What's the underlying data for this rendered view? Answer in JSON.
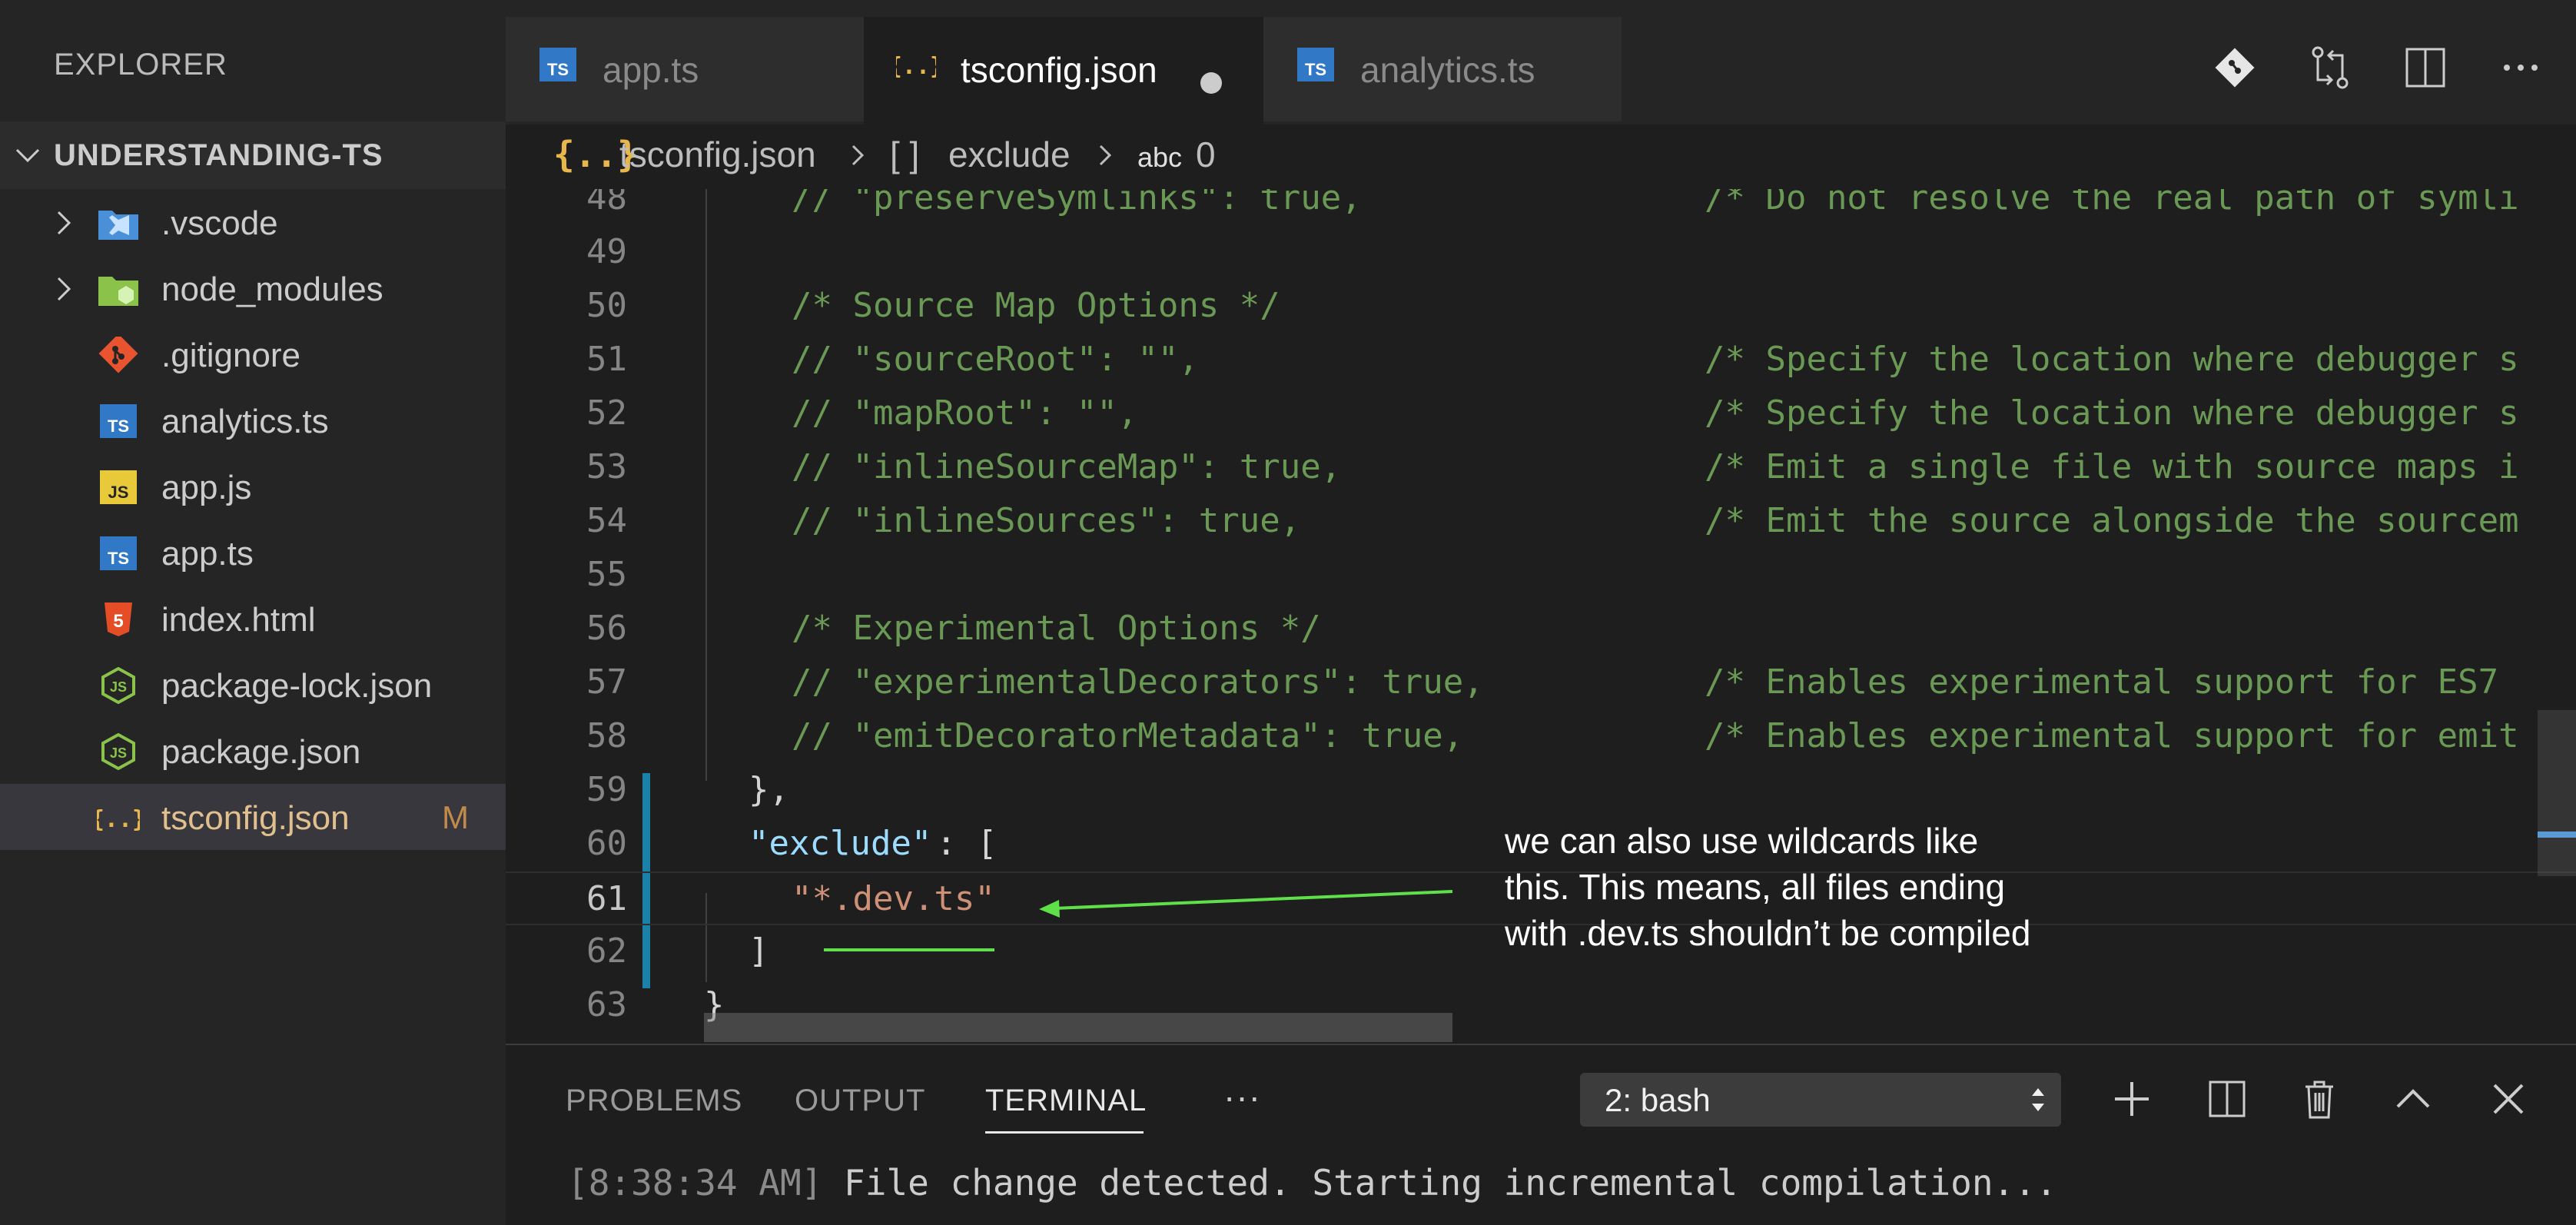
{
  "sidebar": {
    "title": "EXPLORER",
    "section": "UNDERSTANDING-TS",
    "items": [
      {
        "name": ".vscode",
        "folder": true,
        "icon": "vscode-folder-icon"
      },
      {
        "name": "node_modules",
        "folder": true,
        "icon": "node-folder-icon"
      },
      {
        "name": ".gitignore",
        "icon": "git-icon"
      },
      {
        "name": "analytics.ts",
        "icon": "typescript-icon"
      },
      {
        "name": "app.js",
        "icon": "javascript-icon"
      },
      {
        "name": "app.ts",
        "icon": "typescript-icon"
      },
      {
        "name": "index.html",
        "icon": "html-icon"
      },
      {
        "name": "package-lock.json",
        "icon": "node-json-icon"
      },
      {
        "name": "package.json",
        "icon": "node-json-icon"
      },
      {
        "name": "tsconfig.json",
        "icon": "json-icon",
        "badge": "M",
        "selected": true
      }
    ]
  },
  "tabs": [
    {
      "label": "app.ts",
      "icon": "typescript-icon",
      "active": false
    },
    {
      "label": "tsconfig.json",
      "icon": "json-icon",
      "active": true,
      "dirty": true
    },
    {
      "label": "analytics.ts",
      "icon": "typescript-icon",
      "active": false
    }
  ],
  "breadcrumb": {
    "file": "tsconfig.json",
    "file_icon": "{..}",
    "array_icon": "[ ]",
    "key": "exclude",
    "string_icon": "abc",
    "index": "0"
  },
  "editor": {
    "lines": [
      {
        "num": "48",
        "code": "// \"preserveSymlinks\": true,",
        "comment": "/* Do not resolve the real path of symli"
      },
      {
        "num": "49",
        "code": "",
        "comment": ""
      },
      {
        "num": "50",
        "code": "/* Source Map Options */",
        "comment": ""
      },
      {
        "num": "51",
        "code": "// \"sourceRoot\": \"\",",
        "comment": "/* Specify the location where debugger s"
      },
      {
        "num": "52",
        "code": "// \"mapRoot\": \"\",",
        "comment": "/* Specify the location where debugger s"
      },
      {
        "num": "53",
        "code": "// \"inlineSourceMap\": true,",
        "comment": "/* Emit a single file with source maps i"
      },
      {
        "num": "54",
        "code": "// \"inlineSources\": true,",
        "comment": "/* Emit the source alongside the sourcem"
      },
      {
        "num": "55",
        "code": "",
        "comment": ""
      },
      {
        "num": "56",
        "code": "/* Experimental Options */",
        "comment": ""
      },
      {
        "num": "57",
        "code": "// \"experimentalDecorators\": true,",
        "comment": "/* Enables experimental support for ES7"
      },
      {
        "num": "58",
        "code": "// \"emitDecoratorMetadata\": true,",
        "comment": "/* Enables experimental support for emit"
      },
      {
        "num": "59",
        "code": "},",
        "comment": ""
      },
      {
        "num": "60",
        "key": "\"exclude\"",
        "rest": ": [",
        "comment": ""
      },
      {
        "num": "61",
        "str": "\"*.dev.ts\"",
        "comment": ""
      },
      {
        "num": "62",
        "code": "]",
        "comment": ""
      },
      {
        "num": "63",
        "code": "}",
        "comment": ""
      }
    ]
  },
  "annotation": {
    "line1": "we can also use wildcards like",
    "line2": "this. This means, all files ending",
    "line3": "with .dev.ts shouldn’t be compiled",
    "color": "#5fe04a"
  },
  "panel": {
    "tabs": [
      "PROBLEMS",
      "OUTPUT",
      "TERMINAL"
    ],
    "more": "···",
    "terminal_select": "2: bash",
    "terminal_time": "8:38:34 AM",
    "terminal_msg": " File change detected. Starting incremental compilation..."
  },
  "colors": {
    "ts_blue": "#3178c6",
    "json_yellow": "#e8b64a",
    "modified": "#c08b4a"
  }
}
